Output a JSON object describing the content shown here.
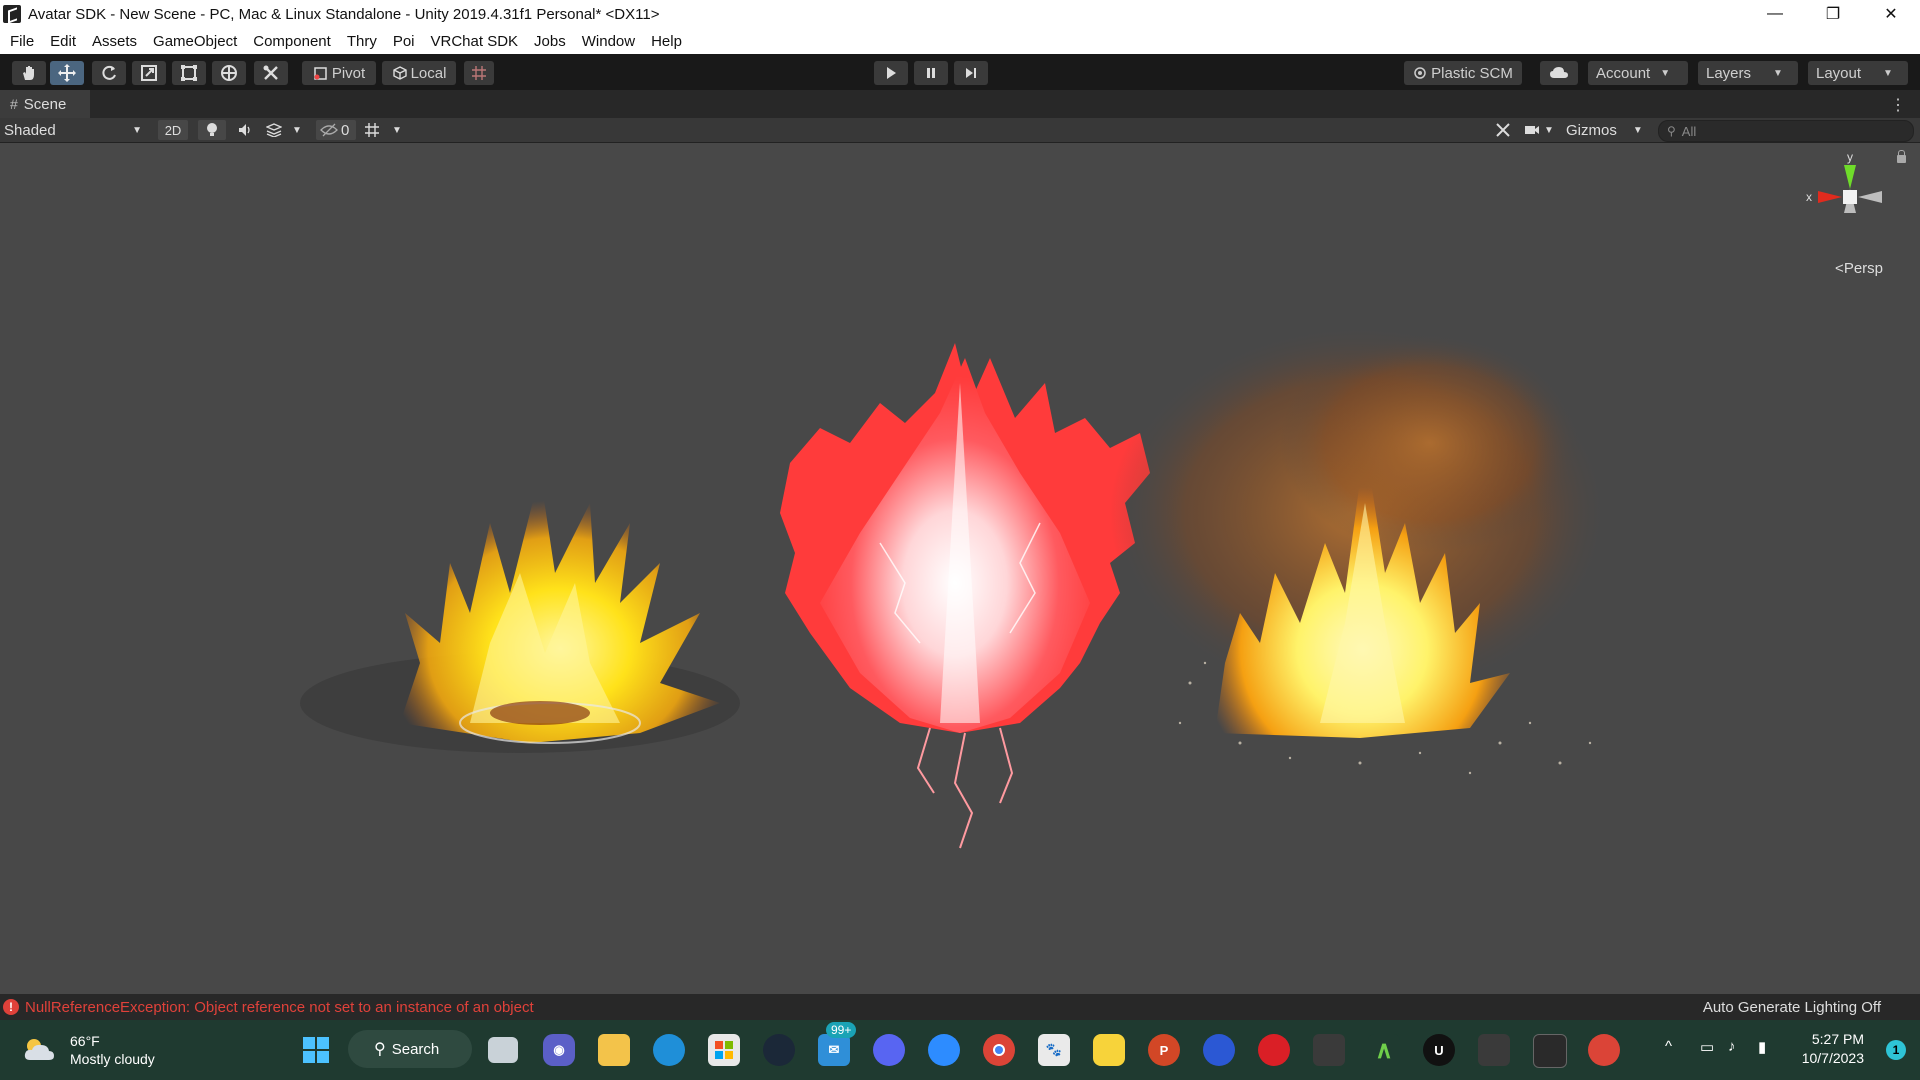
{
  "window": {
    "title": "Avatar SDK - New Scene - PC, Mac & Linux Standalone - Unity 2019.4.31f1 Personal* <DX11>",
    "controls": {
      "minimize": "—",
      "restore": "❐",
      "close": "✕"
    }
  },
  "menu": [
    "File",
    "Edit",
    "Assets",
    "GameObject",
    "Component",
    "Thry",
    "Poi",
    "VRChat SDK",
    "Jobs",
    "Window",
    "Help"
  ],
  "toolbar": {
    "tools": [
      "hand-tool",
      "move-tool",
      "rotate-tool",
      "scale-tool",
      "rect-tool",
      "transform-tool",
      "custom-tool"
    ],
    "active_tool": "move-tool",
    "pivot_label": "Pivot",
    "local_label": "Local",
    "plastic_label": "Plastic SCM",
    "account_label": "Account",
    "layers_label": "Layers",
    "layout_label": "Layout"
  },
  "tab": {
    "label": "Scene"
  },
  "scene_toolbar": {
    "draw_mode": "Shaded",
    "mode_2d": "2D",
    "hidden_count": "0",
    "gizmos_label": "Gizmos",
    "search_placeholder": "All"
  },
  "viewport": {
    "gizmo_y": "y",
    "gizmo_x": "x",
    "persp_label": "Persp",
    "effects": [
      {
        "name": "yellow-flame-aura",
        "colors": [
          "#ffe21a",
          "#f7b30f",
          "#c85c10"
        ]
      },
      {
        "name": "red-lightning-aura",
        "colors": [
          "#ffffff",
          "#ff9aa0",
          "#ff3b3b"
        ]
      },
      {
        "name": "orange-fire-smoke-aura",
        "colors": [
          "#fff36a",
          "#f5a012",
          "#8a4a1e"
        ]
      }
    ]
  },
  "status": {
    "error": "NullReferenceException: Object reference not set to an instance of an object",
    "lighting": "Auto Generate Lighting Off"
  },
  "taskbar": {
    "weather_temp": "66°F",
    "weather_desc": "Mostly cloudy",
    "search_label": "Search",
    "mail_badge": "99+",
    "time": "5:27 PM",
    "date": "10/7/2023",
    "notifications": "1",
    "accent": "#2ec4d6"
  }
}
